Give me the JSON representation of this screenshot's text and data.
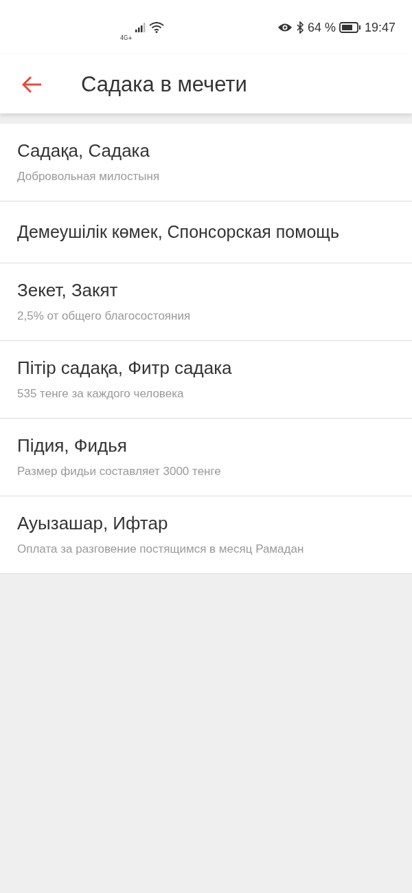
{
  "status_bar": {
    "network": "4G+",
    "battery_percent": "64 %",
    "time": "19:47"
  },
  "header": {
    "title": "Садака в мечети"
  },
  "items": [
    {
      "title": "Садақа, Садака",
      "subtitle": "Добровольная милостыня"
    },
    {
      "title": "Демеушілік көмек, Спонсорская помощь"
    },
    {
      "title": "Зекет, Закят",
      "subtitle": "2,5% от общего благосостояния"
    },
    {
      "title": "Пітір садақа, Фитр садака",
      "subtitle": "535 тенге за каждого человека"
    },
    {
      "title": "Підия, Фидья",
      "subtitle": "Размер фидьи составляет 3000 тенге"
    },
    {
      "title": "Ауызашар, Ифтар",
      "subtitle": "Оплата за разговение постящимся в месяц Рамадан"
    }
  ]
}
